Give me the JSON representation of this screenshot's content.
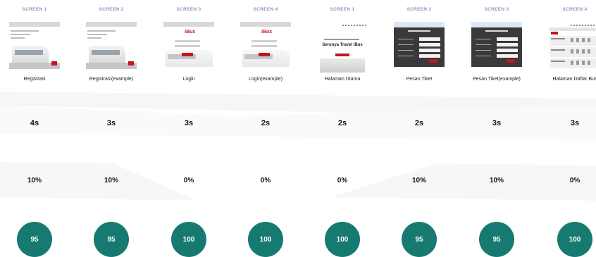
{
  "columns": [
    {
      "screen": "SCREEN 1",
      "name": "Registrasi",
      "time": "4s",
      "rate": "10%",
      "score": "95",
      "thumb": "registrasi"
    },
    {
      "screen": "SCREEN 2",
      "name": "Registrasi(example)",
      "time": "3s",
      "rate": "10%",
      "score": "95",
      "thumb": "registrasi"
    },
    {
      "screen": "SCREEN 3",
      "name": "Login",
      "time": "3s",
      "rate": "0%",
      "score": "100",
      "thumb": "login"
    },
    {
      "screen": "SCREEN 4",
      "name": "Login(example)",
      "time": "2s",
      "rate": "0%",
      "score": "100",
      "thumb": "login"
    },
    {
      "screen": "SCREEN 1",
      "name": "Halaman Utama",
      "time": "2s",
      "rate": "0%",
      "score": "100",
      "thumb": "home"
    },
    {
      "screen": "SCREEN 2",
      "name": "Pesan Tiket",
      "time": "2s",
      "rate": "10%",
      "score": "95",
      "thumb": "ticket"
    },
    {
      "screen": "SCREEN 3",
      "name": "Pesan Tiket(example)",
      "time": "3s",
      "rate": "10%",
      "score": "95",
      "thumb": "ticket"
    },
    {
      "screen": "SCREEN 4",
      "name": "Halaman Daftar Bus",
      "time": "3s",
      "rate": "0%",
      "score": "100",
      "thumb": "buslist"
    }
  ],
  "thumb_text": {
    "home_title": "Serunya Travel iBus",
    "logo": "iBus"
  },
  "colors": {
    "score_circle": "#167a71",
    "accent_red": "#c0161f",
    "screen_label": "#8a93b8"
  }
}
